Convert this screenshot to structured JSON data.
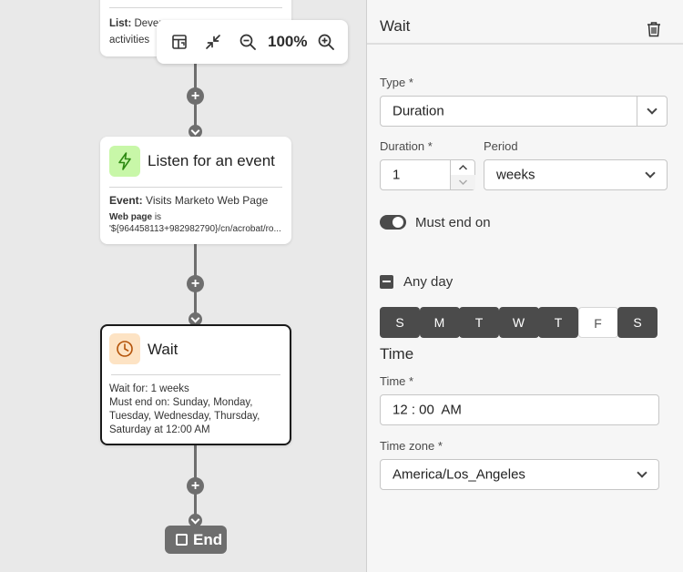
{
  "canvas": {
    "top_card": {
      "line1_label": "List:",
      "line1_value": "Dever",
      "line2": "activities"
    },
    "zoom": {
      "level": "100%"
    },
    "listen_card": {
      "title": "Listen for an event",
      "event_label": "Event:",
      "event_value": "Visits Marketo Web Page",
      "webpage_label": "Web page",
      "webpage_suffix": "is",
      "webpage_value": "'${964458113+982982790}/cn/acrobat/ro..."
    },
    "wait_card": {
      "title": "Wait",
      "line1": "Wait for: 1 weeks",
      "line2": "Must end on: Sunday, Monday,",
      "line3": "Tuesday, Wednesday, Thursday,",
      "line4": "Saturday at 12:00 AM"
    },
    "end_label": "End",
    "plus_symbol": "+"
  },
  "panel": {
    "title": "Wait",
    "type_label": "Type",
    "type_value": "Duration",
    "duration_label": "Duration",
    "duration_value": "1",
    "period_label": "Period",
    "period_value": "weeks",
    "required_marker": "*",
    "must_end_label": "Must end on",
    "any_day_label": "Any day",
    "days": [
      {
        "label": "S",
        "selected": true
      },
      {
        "label": "M",
        "selected": true
      },
      {
        "label": "T",
        "selected": true
      },
      {
        "label": "W",
        "selected": true
      },
      {
        "label": "T",
        "selected": true
      },
      {
        "label": "F",
        "selected": false
      },
      {
        "label": "S",
        "selected": true
      }
    ],
    "time_heading": "Time",
    "time_label": "Time",
    "time_value": "12 : 00  AM",
    "timezone_label": "Time zone",
    "timezone_value": "America/Los_Angeles"
  },
  "colors": {
    "canvas_bg": "#e9e9e9",
    "panel_bg": "#f6f6f6",
    "connector": "#6e6e6e",
    "event_icon_bg": "#c8f7a8",
    "event_icon_fg": "#2d8a12",
    "wait_icon_bg": "#fde3c4",
    "wait_icon_fg": "#b45309",
    "day_selected": "#4b4b4b"
  }
}
